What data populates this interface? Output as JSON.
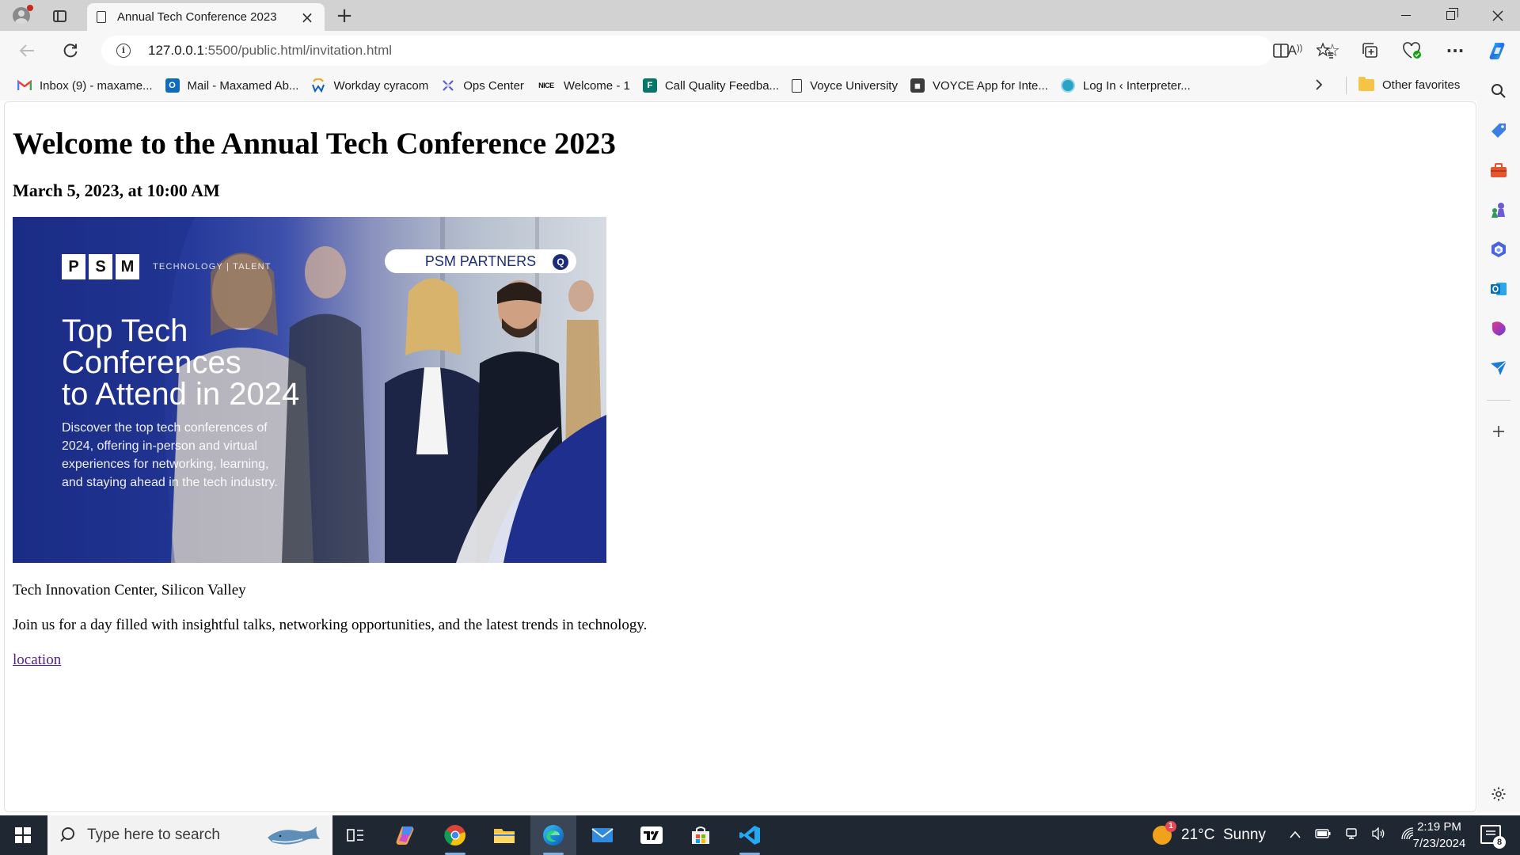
{
  "browser": {
    "tab_title": "Annual Tech Conference 2023",
    "tab_close": "×",
    "new_tab": "+",
    "url_host": "127.0.0.1",
    "url_path": ":5500/public.html/invitation.html",
    "read_aloud": "A",
    "favorites": [
      {
        "label": "Inbox (9) - maxame...",
        "icon": "gmail-icon",
        "color": "#ea4335"
      },
      {
        "label": "Mail - Maxamed Ab...",
        "icon": "outlook-icon",
        "color": "#0f6cbd"
      },
      {
        "label": "Workday cyracom",
        "icon": "workday-icon",
        "color": "#f5a623"
      },
      {
        "label": "Ops Center",
        "icon": "ops-center-icon",
        "color": "#5b5fc7"
      },
      {
        "label": "Welcome - 1",
        "icon": "nice-icon",
        "color": "#111111"
      },
      {
        "label": "Call Quality Feedba...",
        "icon": "forms-icon",
        "color": "#077568"
      },
      {
        "label": "Voyce University",
        "icon": "page-icon",
        "color": "#ffffff"
      },
      {
        "label": "VOYCE App for Inte...",
        "icon": "voyce-app-icon",
        "color": "#3b3b3b"
      },
      {
        "label": "Log In ‹ Interpreter...",
        "icon": "globe-icon",
        "color": "#2aa3c4"
      }
    ],
    "other_favorites": "Other favorites"
  },
  "page": {
    "heading": "Welcome to the Annual Tech Conference 2023",
    "date": "March 5, 2023, at 10:00 AM",
    "location_text": "Tech Innovation Center, Silicon Valley",
    "description": "Join us for a day filled with insightful talks, networking opportunities, and the latest trends in technology.",
    "link_text": "location",
    "hero": {
      "brand_letters": [
        "P",
        "S",
        "M"
      ],
      "brand_tagline": "TECHNOLOGY | TALENT",
      "partners_label": "PSM PARTNERS",
      "title": "Top Tech\nConferences\nto Attend in 2024",
      "description": "Discover the top tech conferences of\n2024, offering in-person and virtual\nexperiences for networking, learning,\nand staying ahead in the tech industry."
    }
  },
  "taskbar": {
    "search_placeholder": "Type here to search",
    "weather": "21°C  Sunny",
    "weather_badge": "1",
    "time": "2:19 PM",
    "date": "7/23/2024",
    "notification_count": "8"
  }
}
